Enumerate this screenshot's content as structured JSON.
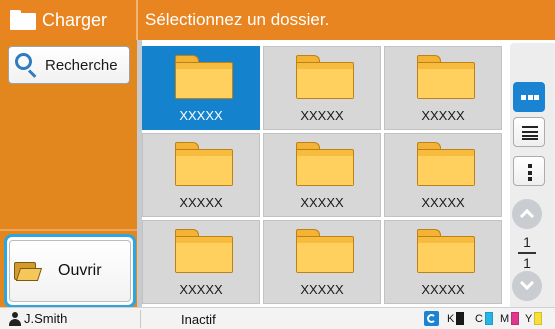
{
  "header": {
    "title": "Charger",
    "message": "Sélectionnez un dossier."
  },
  "sidebar": {
    "search_label": "Recherche",
    "open_label": "Ouvrir"
  },
  "folders": [
    {
      "name": "XXXXX",
      "selected": true
    },
    {
      "name": "XXXXX",
      "selected": false
    },
    {
      "name": "XXXXX",
      "selected": false
    },
    {
      "name": "XXXXX",
      "selected": false
    },
    {
      "name": "XXXXX",
      "selected": false
    },
    {
      "name": "XXXXX",
      "selected": false
    },
    {
      "name": "XXXXX",
      "selected": false
    },
    {
      "name": "XXXXX",
      "selected": false
    },
    {
      "name": "XXXXX",
      "selected": false
    }
  ],
  "view_controls": {
    "active_view": "thumbnail-view",
    "icons": [
      "thumbnail-view-icon",
      "list-view-icon",
      "more-menu-icon"
    ]
  },
  "pagination": {
    "current": "1",
    "total": "1"
  },
  "status_bar": {
    "user": "J.Smith",
    "status": "Inactif",
    "inks": [
      {
        "letter": "K",
        "color": "#1a1a1a"
      },
      {
        "letter": "C",
        "color": "#27B4E6"
      },
      {
        "letter": "M",
        "color": "#E0368E"
      },
      {
        "letter": "Y",
        "color": "#F7E03A"
      }
    ]
  },
  "colors": {
    "accent": "#E88520",
    "selection": "#1582CE",
    "focus_ring": "#2BA6E0"
  }
}
